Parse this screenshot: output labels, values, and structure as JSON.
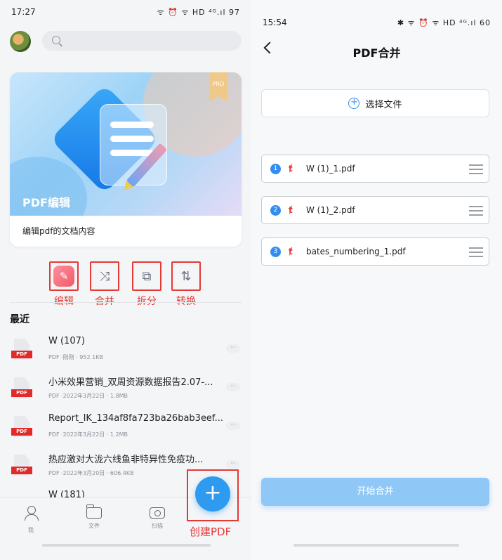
{
  "left": {
    "status_bar": {
      "time": "17:27",
      "icons": "ᯤ ⏰ ᯤ HD ⁴ᴳ.ıl 97"
    },
    "banner": {
      "pro_label": "PRO",
      "title": "PDF编辑",
      "description": "编辑pdf的文档内容"
    },
    "tools": [
      {
        "label": "编辑",
        "icon": "edit-icon"
      },
      {
        "label": "合并",
        "icon": "shuffle-icon"
      },
      {
        "label": "拆分",
        "icon": "split-icon"
      },
      {
        "label": "转换",
        "icon": "convert-icon"
      }
    ],
    "recent_title": "最近",
    "files": [
      {
        "name": "W (107)",
        "meta": "PDF ·刚刚 · 952.1KB",
        "badge": "PDF"
      },
      {
        "name": "小米效果营销_双周资源数据报告2.07-...",
        "meta": "PDF ·2022年3月22日 · 1.8MB",
        "badge": "PDF"
      },
      {
        "name": "Report_IK_134af8fa723ba26bab3eef...",
        "meta": "PDF ·2022年3月22日 · 1.2MB",
        "badge": "PDF"
      },
      {
        "name": "热应激对大泷六线鱼非特异性免疫功...",
        "meta": "PDF ·2022年3月20日 · 606.4KB",
        "badge": "PDF"
      },
      {
        "name": "W (181)",
        "meta": "",
        "badge": "PDF"
      }
    ],
    "tabs": [
      {
        "label": "我",
        "icon": "person-icon"
      },
      {
        "label": "文件",
        "icon": "folder-icon"
      },
      {
        "label": "扫描",
        "icon": "camera-icon"
      }
    ],
    "fab": {
      "symbol": "+",
      "annotation": "创建PDF"
    },
    "colors": {
      "accent": "#2f9bf0",
      "annotation": "#e53935",
      "pdf_badge": "#e12b2b"
    }
  },
  "right": {
    "status_bar": {
      "time": "15:54",
      "icons": "✱ ᯤ ⏰ ᯤ HD ⁴ᴳ.ıl 60"
    },
    "title": "PDF合并",
    "select_file_label": "选择文件",
    "merge_files": [
      {
        "index": "1",
        "name": "W (1)_1.pdf"
      },
      {
        "index": "2",
        "name": "W (1)_2.pdf"
      },
      {
        "index": "3",
        "name": "bates_numbering_1.pdf"
      }
    ],
    "start_button_label": "开始合并",
    "colors": {
      "accent": "#2f8ef0",
      "button_disabled": "#8fc8f6"
    }
  }
}
